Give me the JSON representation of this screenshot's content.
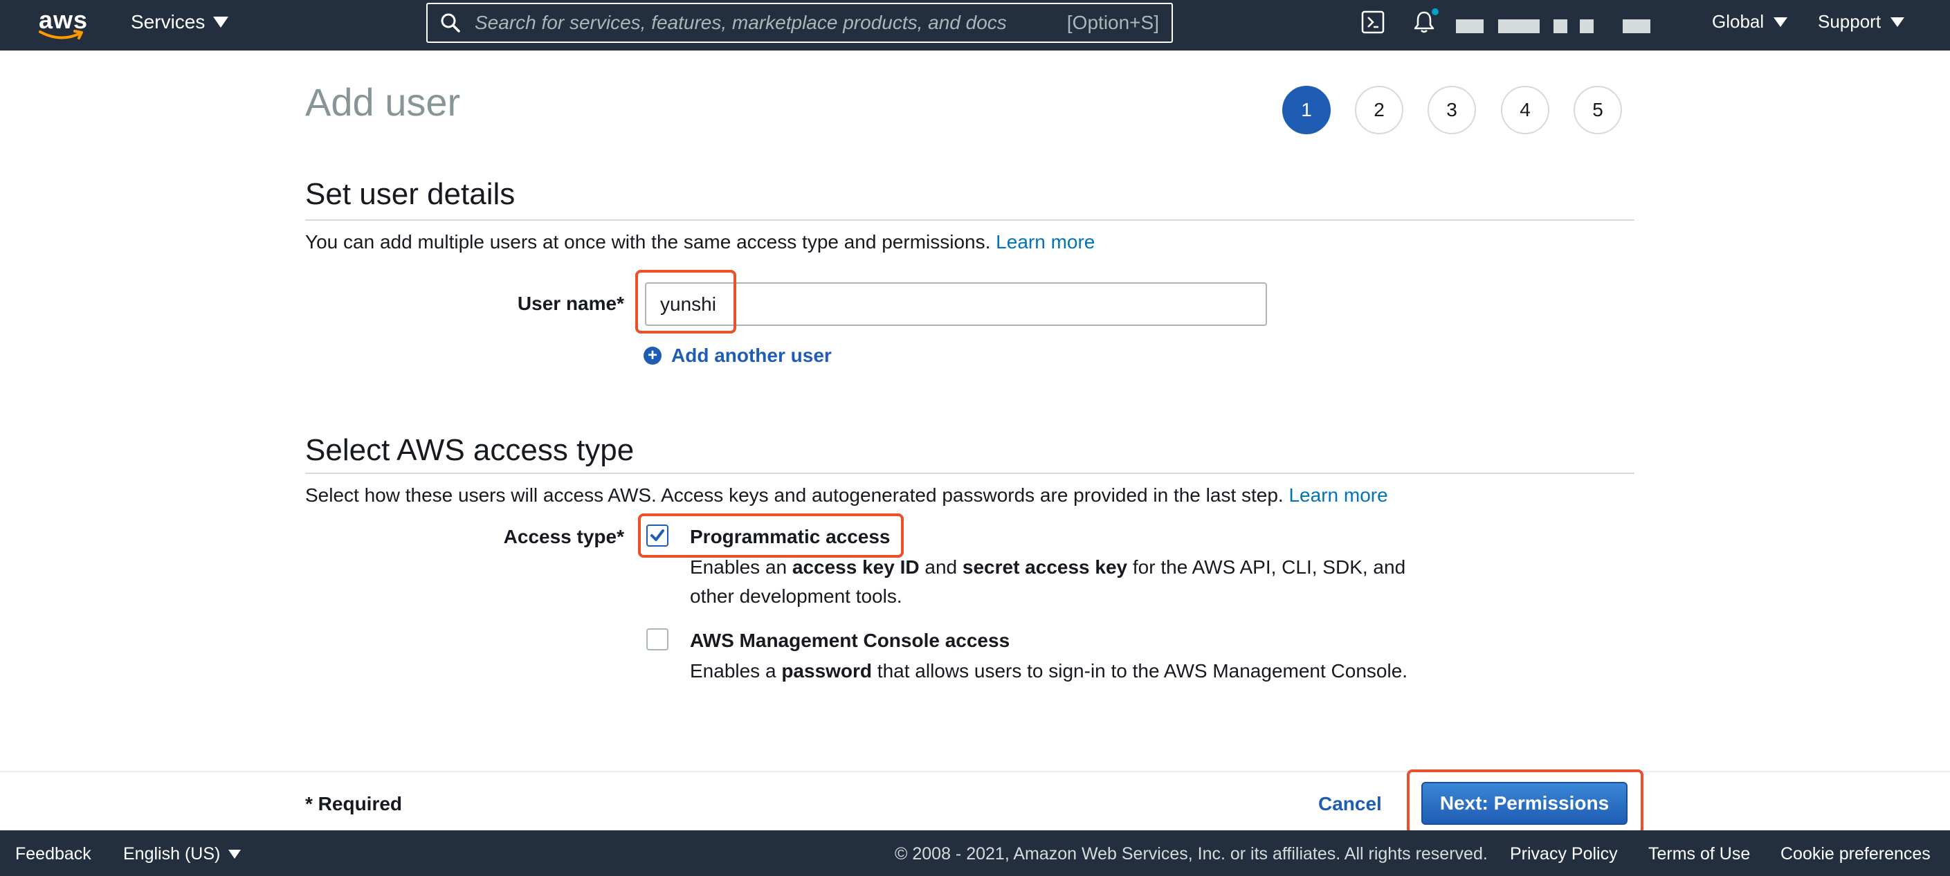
{
  "nav": {
    "logo_text": "aws",
    "services_label": "Services",
    "search_placeholder": "Search for services, features, marketplace products, and docs",
    "search_shortcut": "[Option+S]",
    "region_label": "Global",
    "support_label": "Support"
  },
  "page": {
    "title": "Add user",
    "steps": [
      "1",
      "2",
      "3",
      "4",
      "5"
    ],
    "active_step": "1"
  },
  "user_details": {
    "heading": "Set user details",
    "description": "You can add multiple users at once with the same access type and permissions.",
    "learn_more": "Learn more",
    "user_name_label": "User name*",
    "user_name_value": "yunshi",
    "add_another_user": "Add another user"
  },
  "access_type": {
    "heading": "Select AWS access type",
    "description": "Select how these users will access AWS. Access keys and autogenerated passwords are provided in the last step.",
    "learn_more": "Learn more",
    "label": "Access type*",
    "programmatic": {
      "title": "Programmatic access",
      "checked": true,
      "desc_1": "Enables an ",
      "desc_bold_1": "access key ID",
      "desc_2": " and ",
      "desc_bold_2": "secret access key",
      "desc_3": " for the AWS API, CLI, SDK, and",
      "desc_line2": "other development tools."
    },
    "console": {
      "title": "AWS Management Console access",
      "checked": false,
      "desc_1": "Enables a ",
      "desc_bold_1": "password",
      "desc_2": " that allows users to sign-in to the AWS Management Console."
    }
  },
  "actions": {
    "required_note": "* Required",
    "cancel_label": "Cancel",
    "next_label": "Next: Permissions"
  },
  "footer": {
    "feedback": "Feedback",
    "language": "English (US)",
    "copyright": "© 2008 - 2021, Amazon Web Services, Inc. or its affiliates. All rights reserved.",
    "privacy": "Privacy Policy",
    "terms": "Terms of Use",
    "cookies": "Cookie preferences"
  },
  "colors": {
    "nav_bg": "#232f3e",
    "accent_blue": "#1f5db4",
    "link_blue": "#0073bb",
    "highlight_orange": "#e8512a",
    "muted_gray": "#879596"
  }
}
